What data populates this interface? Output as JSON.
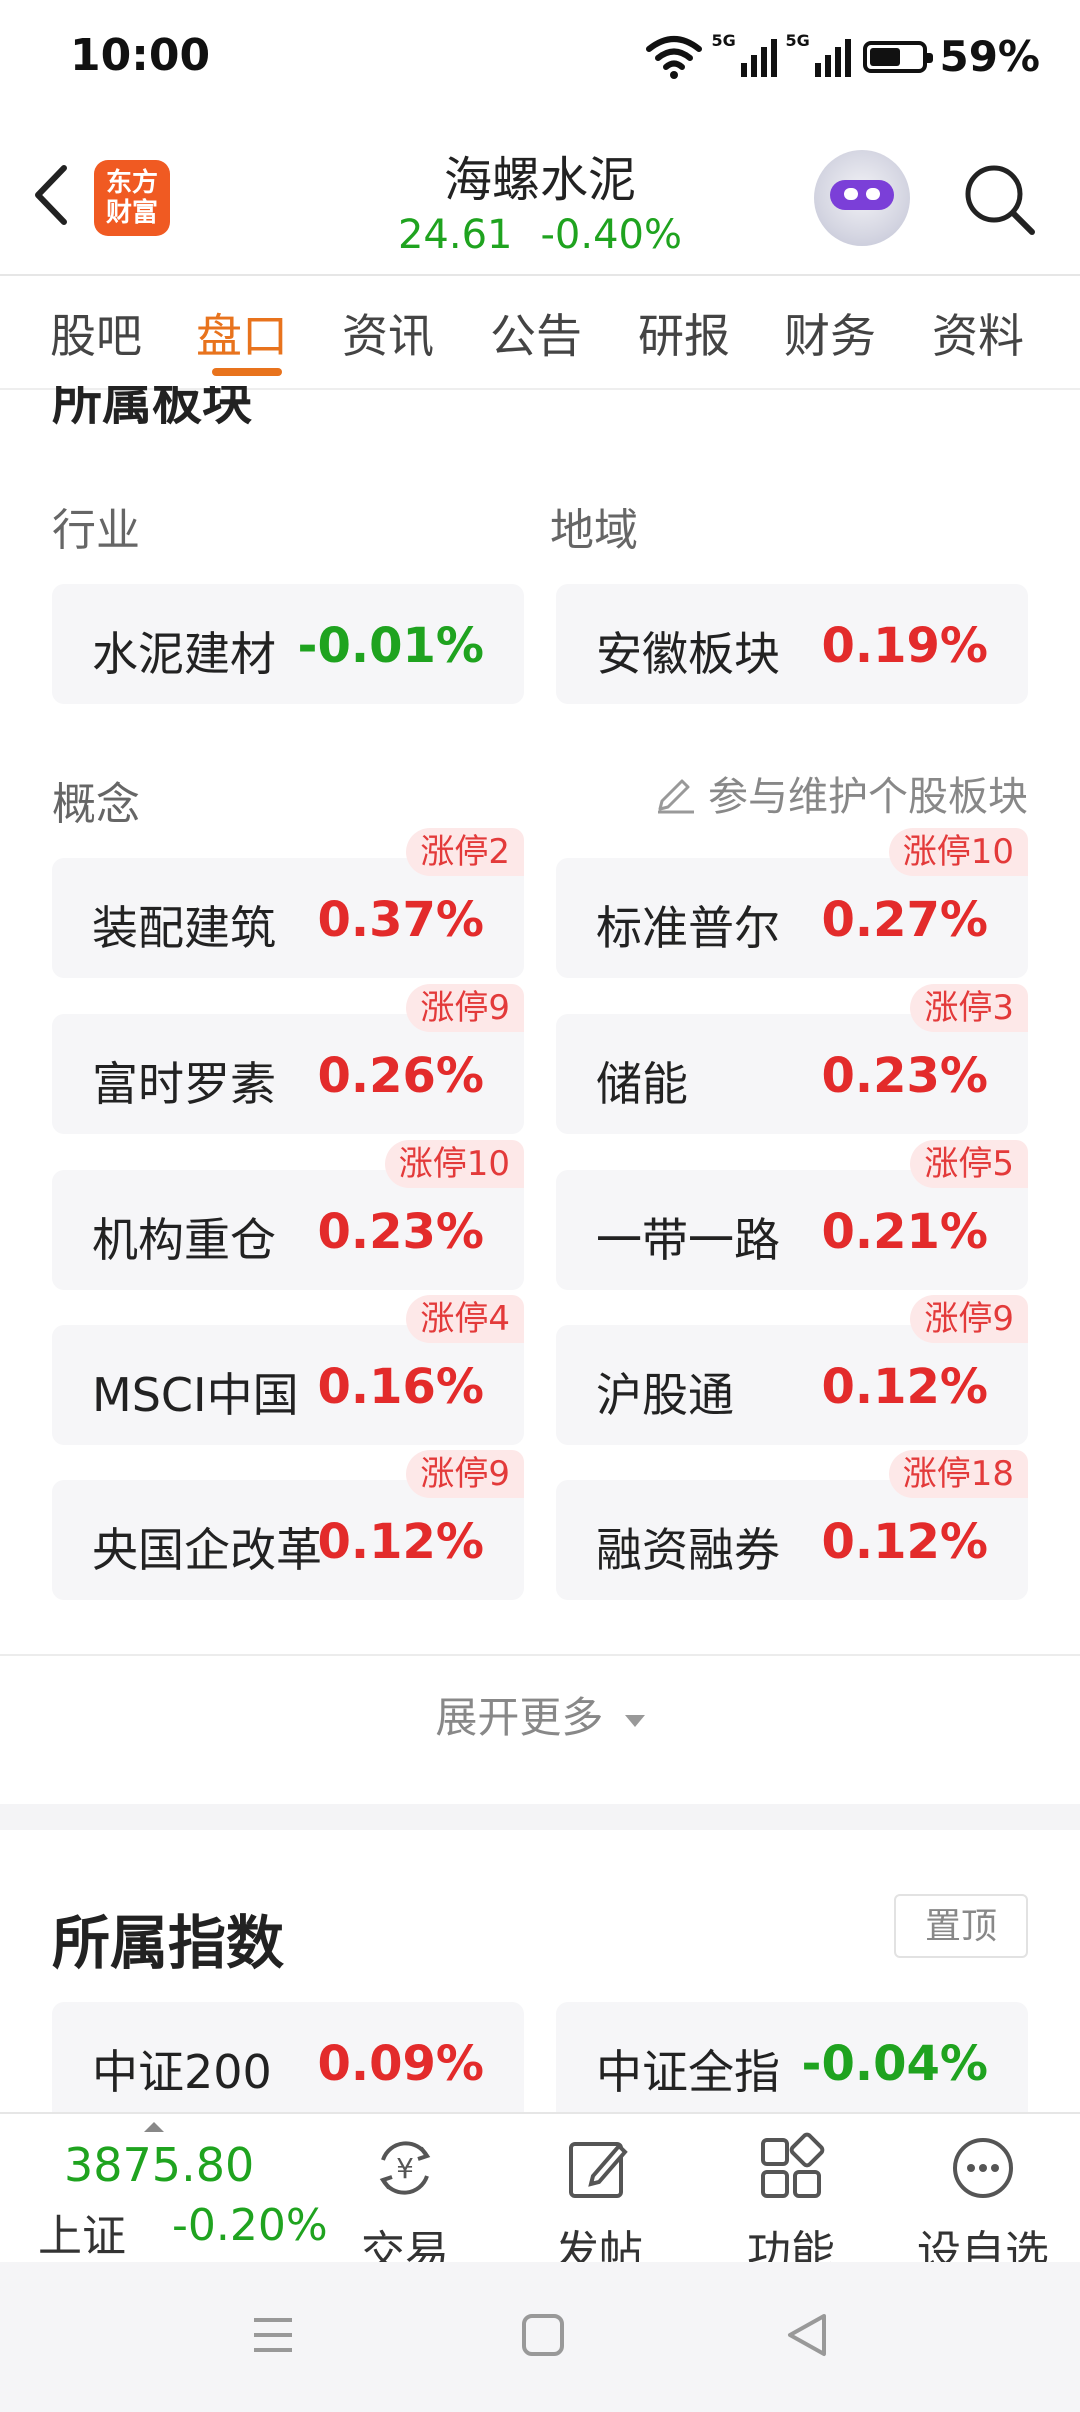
{
  "status_bar": {
    "time": "10:00",
    "net1": "5G",
    "net2": "5G",
    "battery": "59%",
    "battery_level": 0.59
  },
  "header": {
    "logo_line1": "东方",
    "logo_line2": "财富",
    "stock_name": "海螺水泥",
    "price": "24.61",
    "change": "-0.40%"
  },
  "tabs": [
    "股吧",
    "盘口",
    "资讯",
    "公告",
    "研报",
    "财务",
    "资料"
  ],
  "section_title": "所属板块",
  "industry": {
    "label": "行业",
    "name": "水泥建材",
    "pct": "-0.01%"
  },
  "region": {
    "label": "地域",
    "name": "安徽板块",
    "pct": "0.19%"
  },
  "concept_label": "概念",
  "maintain_link": "参与维护个股板块",
  "concepts": [
    {
      "name": "装配建筑",
      "pct": "0.37%",
      "badge": "涨停2"
    },
    {
      "name": "标准普尔",
      "pct": "0.27%",
      "badge": "涨停10"
    },
    {
      "name": "富时罗素",
      "pct": "0.26%",
      "badge": "涨停9"
    },
    {
      "name": "储能",
      "pct": "0.23%",
      "badge": "涨停3"
    },
    {
      "name": "机构重仓",
      "pct": "0.23%",
      "badge": "涨停10"
    },
    {
      "name": "一带一路",
      "pct": "0.21%",
      "badge": "涨停5"
    },
    {
      "name": "MSCI中国",
      "pct": "0.16%",
      "badge": "涨停4"
    },
    {
      "name": "沪股通",
      "pct": "0.12%",
      "badge": "涨停9"
    },
    {
      "name": "央国企改革",
      "pct": "0.12%",
      "badge": "涨停9"
    },
    {
      "name": "融资融券",
      "pct": "0.12%",
      "badge": "涨停18"
    }
  ],
  "expand_more": "展开更多",
  "index_section": {
    "title": "所属指数",
    "pin_label": "置顶",
    "items": [
      {
        "name": "中证200",
        "pct": "0.09%"
      },
      {
        "name": "中证全指",
        "pct": "-0.04%"
      }
    ]
  },
  "bottom_bar": {
    "index_value": "3875.80",
    "index_name": "上证",
    "index_change": "-0.20%",
    "nav": [
      "交易",
      "发帖",
      "功能",
      "设自选"
    ]
  }
}
